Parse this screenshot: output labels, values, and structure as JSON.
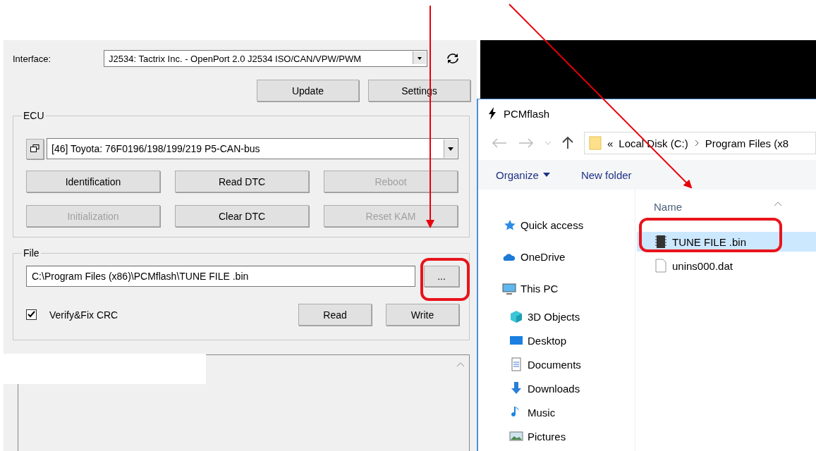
{
  "interface": {
    "label": "Interface:",
    "value": "J2534: Tactrix Inc. - OpenPort 2.0 J2534 ISO/CAN/VPW/PWM"
  },
  "top_buttons": [
    "Update",
    "Settings"
  ],
  "ecu": {
    "title": "ECU",
    "value": "[46] Toyota: 76F0196/198/199/219 P5-CAN-bus",
    "buttons": [
      {
        "label": "Identification",
        "disabled": false
      },
      {
        "label": "Read DTC",
        "disabled": false
      },
      {
        "label": "Reboot",
        "disabled": true
      },
      {
        "label": "Initialization",
        "disabled": true
      },
      {
        "label": "Clear DTC",
        "disabled": false
      },
      {
        "label": "Reset KAM",
        "disabled": true
      }
    ]
  },
  "file": {
    "title": "File",
    "path": "C:\\Program Files (x86)\\PCMflash\\TUNE FILE .bin",
    "browse": "...",
    "verify": {
      "label": "Verify&Fix CRC",
      "checked": true
    },
    "buttons": [
      "Read",
      "Write"
    ]
  },
  "dialog": {
    "title": "PCMflash",
    "breadcrumb": {
      "overflow": "«",
      "items": [
        "Local Disk (C:)",
        "Program Files (x8"
      ]
    },
    "toolbar": {
      "organize": "Organize",
      "new_folder": "New folder"
    },
    "nav": [
      {
        "label": "Quick access",
        "kind": "star"
      },
      {
        "label": "OneDrive",
        "kind": "cloud"
      },
      {
        "label": "This PC",
        "kind": "pc",
        "children": [
          {
            "label": "3D Objects",
            "kind": "cube"
          },
          {
            "label": "Desktop",
            "kind": "desktop"
          },
          {
            "label": "Documents",
            "kind": "doc"
          },
          {
            "label": "Downloads",
            "kind": "down"
          },
          {
            "label": "Music",
            "kind": "music"
          },
          {
            "label": "Pictures",
            "kind": "pictures"
          }
        ]
      }
    ],
    "column": "Name",
    "files": [
      {
        "name": "TUNE FILE .bin",
        "kind": "binary",
        "selected": true
      },
      {
        "name": "unins000.dat",
        "kind": "generic",
        "selected": false
      }
    ]
  }
}
